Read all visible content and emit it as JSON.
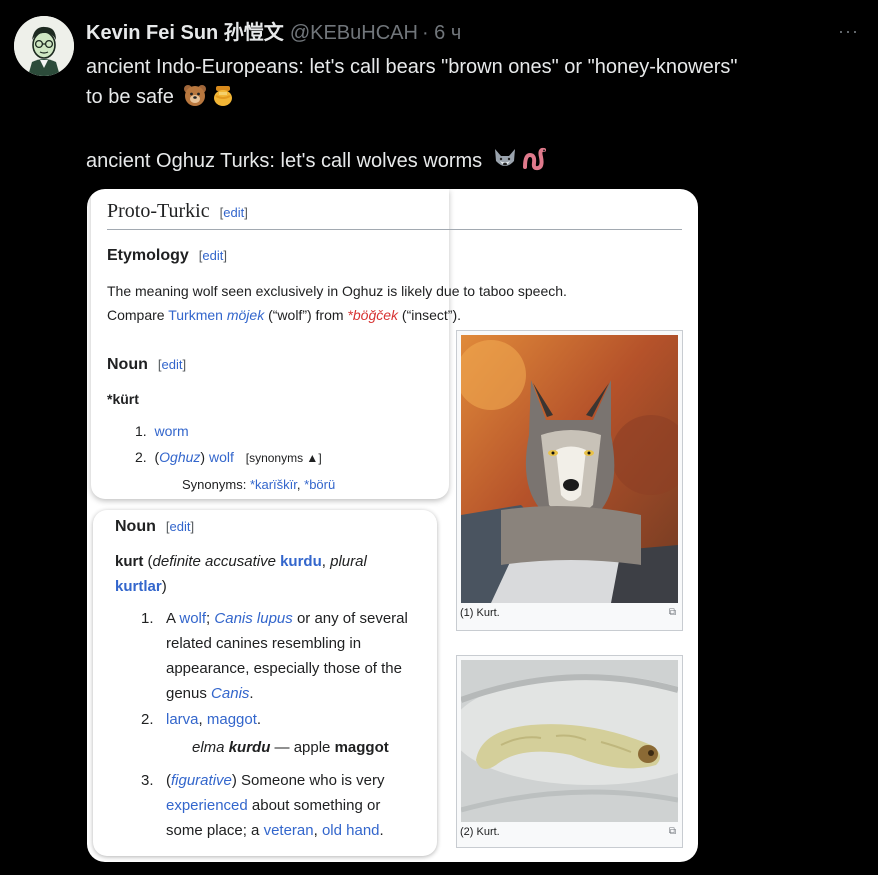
{
  "tweet": {
    "author_name": "Kevin Fei Sun 孙愷文",
    "handle": "@KEBuHCAH",
    "time": "· 6 ч",
    "more": "···",
    "line1": "ancient Indo-Europeans: let's call bears \"brown ones\" or \"honey-knowers\"",
    "line2": "to be safe",
    "line3": "ancient Oghuz Turks: let's call wolves worms",
    "emoji_bear": "🐻",
    "emoji_honey": "🍯",
    "emoji_wolf": "🐺",
    "emoji_worm": "🪱"
  },
  "wiki": {
    "section_title": "Proto-Turkic",
    "edit": "edit",
    "etymology_heading": "Etymology",
    "etymology_line1": "The meaning wolf seen exclusively in Oghuz is likely due to taboo speech.",
    "compare": "Compare",
    "turkmen": "Turkmen",
    "mojek": "möjek",
    "wolf_gloss": "(“wolf”) from",
    "bogcek": "*böğček",
    "insect_gloss": "(“insect”).",
    "noun1_heading": "Noun",
    "headword1": "*kürt",
    "sense1_num": "1.",
    "sense1": "worm",
    "sense2_num": "2.",
    "oghuz": "Oghuz",
    "sense2_wolf": "wolf",
    "synonyms_toggle": "[synonyms ▲]",
    "synonyms_label": "Synonyms:",
    "syn1": "*karïškïr",
    "syn2": "*börü",
    "noun2_heading": "Noun",
    "headword2": "kurt",
    "definite_acc": "definite accusative",
    "kurdu": "kurdu",
    "plural": "plural",
    "kurtlar": "kurtlar",
    "d1_num": "1.",
    "d1_a": "A",
    "d1_wolf": "wolf",
    "d1_canis": "Canis lupus",
    "d1_rest1": "or any of several",
    "d1_rest2": "related canines resembling in",
    "d1_rest3": "appearance, especially those of the",
    "d1_genus": "genus",
    "d1_canis2": "Canis",
    "d2_num": "2.",
    "d2_larva": "larva",
    "d2_maggot": "maggot",
    "ex_elma": "elma",
    "ex_kurdu": "kurdu",
    "ex_dash": "— apple",
    "ex_maggot": "maggot",
    "d3_num": "3.",
    "d3_fig": "figurative",
    "d3_rest1": "Someone who is very",
    "d3_experienced": "experienced",
    "d3_rest2": "about something or",
    "d3_rest3": "some place; a",
    "d3_veteran": "veteran",
    "d3_oldhand": "old hand",
    "img1_caption": "(1) Kurt.",
    "img2_caption": "(2) Kurt."
  }
}
